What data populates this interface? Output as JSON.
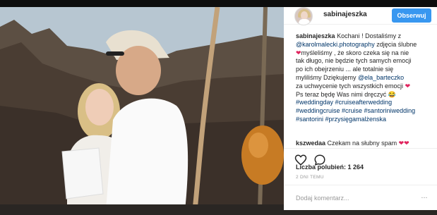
{
  "post": {
    "username": "sabinajeszka",
    "follow_label": "Obserwuj",
    "caption_lines": [
      {
        "pre": "Kochani ! Dostaliśmy z"
      },
      {
        "link": "@karolmalecki.photography",
        "post": " zdjęcia ślubne"
      },
      {
        "pre": "myśleliśmy , że skoro czeka się na nie"
      },
      {
        "pre": "tak długo, nie będzie tych samych emocji"
      },
      {
        "pre": "po ich obejrzeniu ... ale totalnie się"
      },
      {
        "pre": "myliliśmy  Dziękujemy ",
        "link": "@ela_barteczko"
      },
      {
        "pre": "za uchwycenie tych wszystkich emocji "
      },
      {
        "pre": "Ps teraz będę Was nimi dręczyć "
      },
      {
        "link": "#weddingday #cruiseafterwedding"
      },
      {
        "link": "#weddingcruise #cruise #santoriniwedding"
      },
      {
        "link": "#santorini #przysięgamalżenska"
      }
    ],
    "comment": {
      "user": "kszwedaa",
      "text": "Czekam na słubny spam"
    },
    "likes_text": "Liczba polubień: 1 264",
    "time_text": "2 DNI TEMU",
    "comment_placeholder": "Dodaj komentarz...",
    "more_label": "..."
  },
  "icons": [
    "heart-icon",
    "comment-icon",
    "more-options-icon"
  ],
  "colors": {
    "follow": "#3897f0",
    "link": "#003569",
    "heart": "#e0245e"
  }
}
